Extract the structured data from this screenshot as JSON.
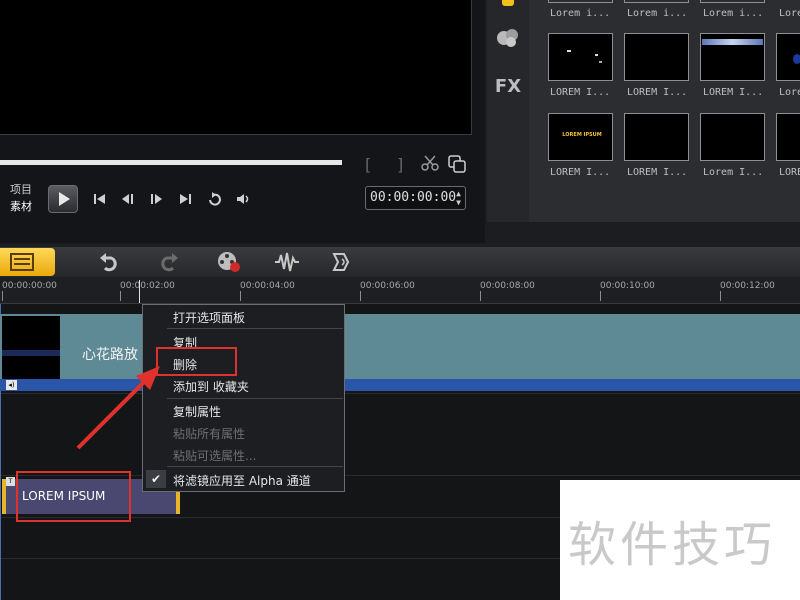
{
  "preview": {
    "mode_project": "项目",
    "mode_clip": "素材",
    "timecode": "00:00:00:00",
    "mark_in": "[",
    "mark_out": "]"
  },
  "library": {
    "fx_label": "FX",
    "thumbnails_row1": [
      "Lorem i...",
      "Lorem i...",
      "Lorem i...",
      "Lorem i..."
    ],
    "thumbnails_row2": [
      "LOREM I...",
      "LOREM I...",
      "LOREM I...",
      "Lore"
    ],
    "thumbnails_row3": [
      "LOREM I...",
      "LOREM I...",
      "Lorem I...",
      "LOREM"
    ],
    "thumb_text": "LOREM IPSUM"
  },
  "ruler": {
    "ticks": [
      "00:00:00:00",
      "00:00:02:00",
      "00:00:04:00",
      "00:00:06:00",
      "00:00:08:00",
      "00:00:10:00",
      "00:00:12:00"
    ]
  },
  "tracks": {
    "video_clip_title": "心花路放",
    "title_clip_label": "LOREM IPSUM"
  },
  "context_menu": {
    "items": [
      {
        "label": "打开选项面板",
        "enabled": true
      },
      {
        "label": "复制",
        "enabled": true
      },
      {
        "label": "删除",
        "enabled": true
      },
      {
        "label": "添加到 收藏夹",
        "enabled": true
      },
      {
        "label": "复制属性",
        "enabled": true
      },
      {
        "label": "粘贴所有属性",
        "enabled": false
      },
      {
        "label": "粘贴可选属性...",
        "enabled": false
      },
      {
        "label": "将滤镜应用至 Alpha 通道",
        "enabled": true,
        "checked": true
      }
    ]
  },
  "colors": {
    "highlight": "#e0322d",
    "accent_yellow": "#f2c21b",
    "video_track": "#5e8a95",
    "audio_strip": "#2a55a8",
    "title_clip": "#4a4770"
  },
  "watermark": "软件技巧"
}
